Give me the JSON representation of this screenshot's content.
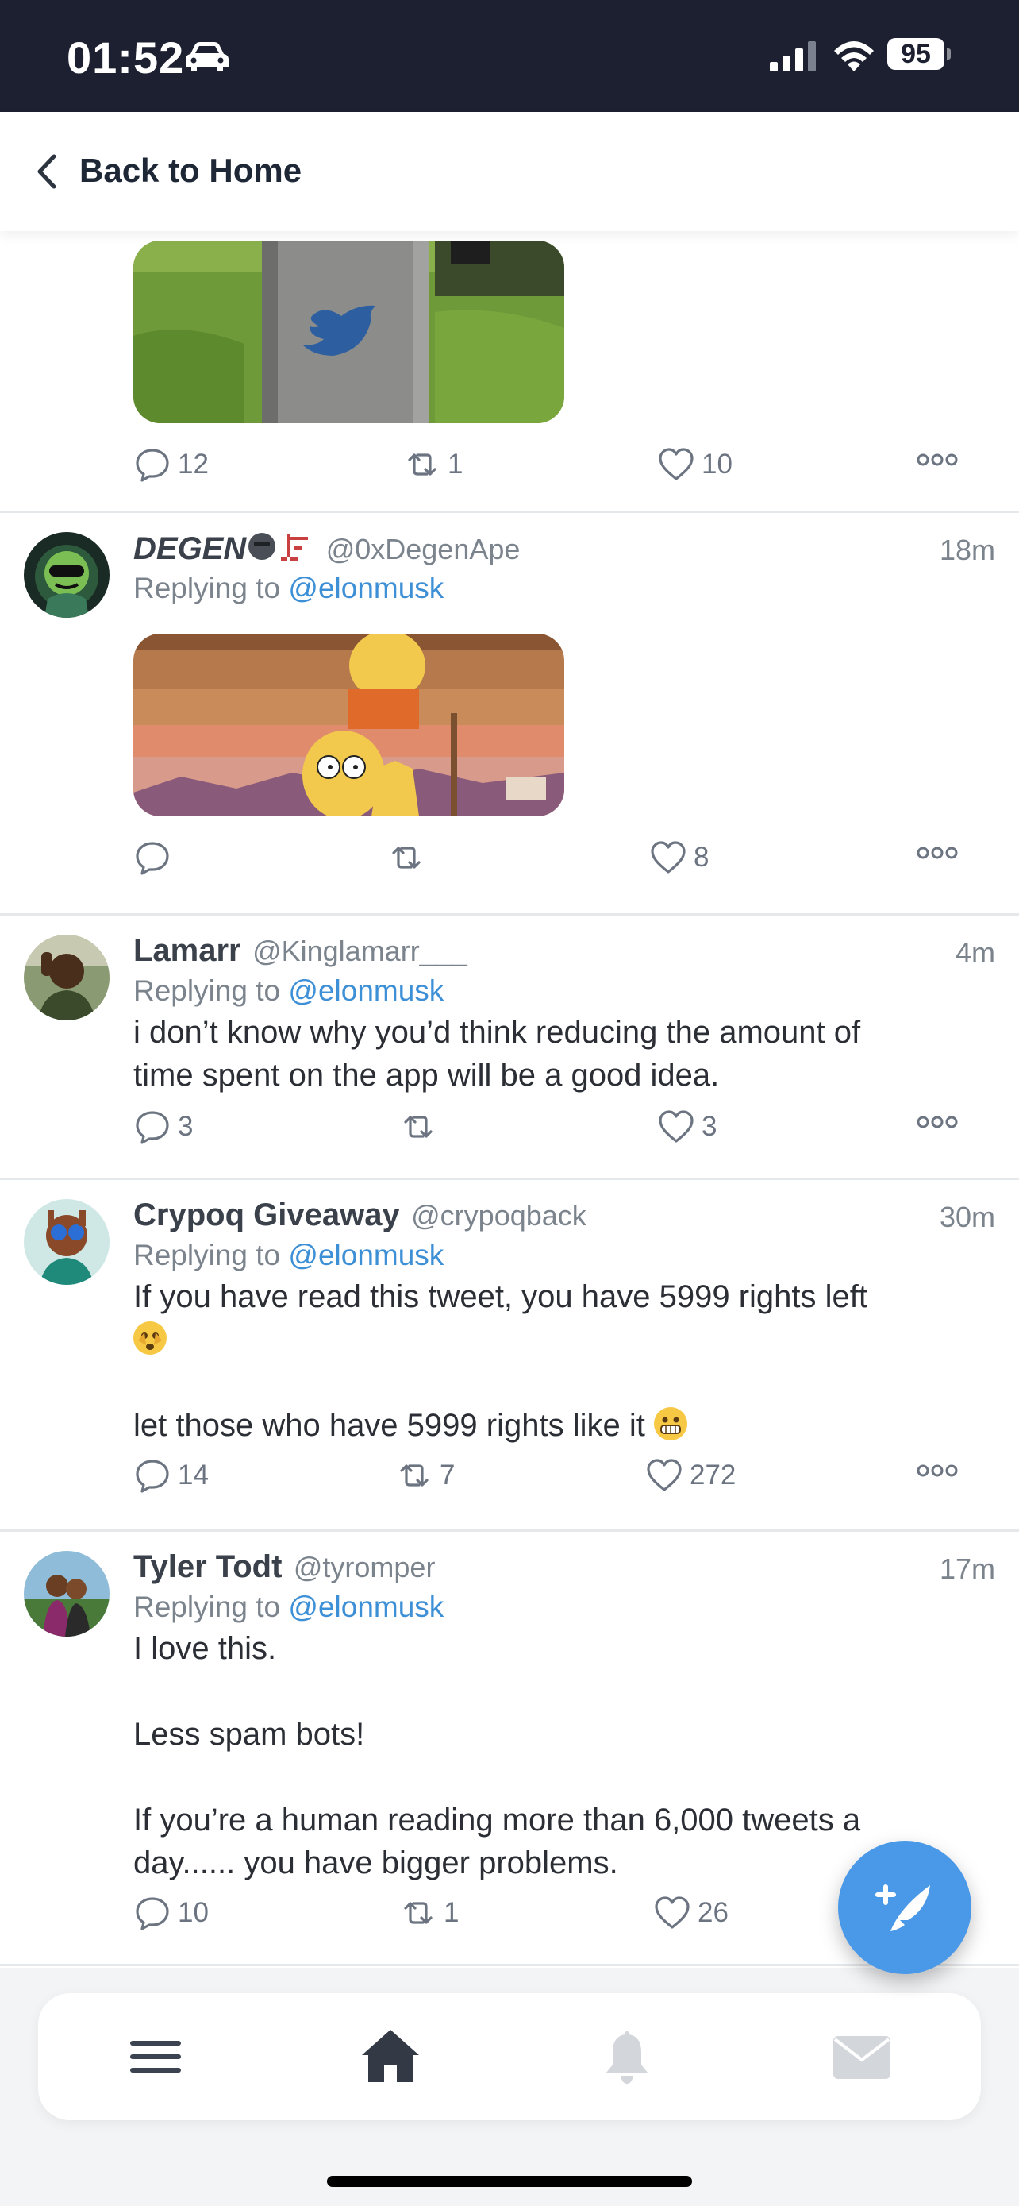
{
  "status_bar": {
    "time": "01:52",
    "battery": "95"
  },
  "header": {
    "back_label": "Back to Home"
  },
  "tweets": [
    {
      "counts": {
        "reply": "12",
        "retweet": "1",
        "like": "10"
      }
    },
    {
      "name": "DEGEN",
      "handle": "@0xDegenApe",
      "time": "18m",
      "replying_prefix": "Replying to",
      "replying_to": "@elonmusk",
      "counts": {
        "reply": "",
        "retweet": "",
        "like": "8"
      }
    },
    {
      "name": "Lamarr",
      "handle": "@Kinglamarr___",
      "time": "4m",
      "replying_prefix": "Replying to",
      "replying_to": "@elonmusk",
      "text_lines": [
        "i don’t know why you’d think reducing the amount of",
        "time spent on the app will  be a good idea."
      ],
      "counts": {
        "reply": "3",
        "retweet": "",
        "like": "3"
      }
    },
    {
      "name": "Crypoq Giveaway",
      "handle": "@crypoqback",
      "time": "30m",
      "replying_prefix": "Replying to",
      "replying_to": "@elonmusk",
      "text_lines": [
        "If you have read this tweet, you have 5999 rights left",
        "",
        "",
        "let those who have 5999 rights like it"
      ],
      "counts": {
        "reply": "14",
        "retweet": "7",
        "like": "272"
      }
    },
    {
      "name": "Tyler Todt",
      "handle": "@tyromper",
      "time": "17m",
      "replying_prefix": "Replying to",
      "replying_to": "@elonmusk",
      "text_lines": [
        "I love this.",
        "",
        "Less spam bots!",
        "",
        "If you’re a human reading more than 6,000 tweets a",
        "day...... you have bigger problems."
      ],
      "counts": {
        "reply": "10",
        "retweet": "1",
        "like": "26"
      }
    }
  ],
  "icons": {
    "reply": "reply-icon",
    "retweet": "retweet-icon",
    "like": "heart-icon",
    "more": "more-icon",
    "compose": "compose-icon",
    "menu": "menu-icon",
    "home": "home-icon",
    "notifications": "bell-icon",
    "messages": "mail-icon"
  },
  "colors": {
    "accent": "#4a99e9",
    "mention": "#3d8fd6",
    "status_bar": "#1c2030"
  }
}
